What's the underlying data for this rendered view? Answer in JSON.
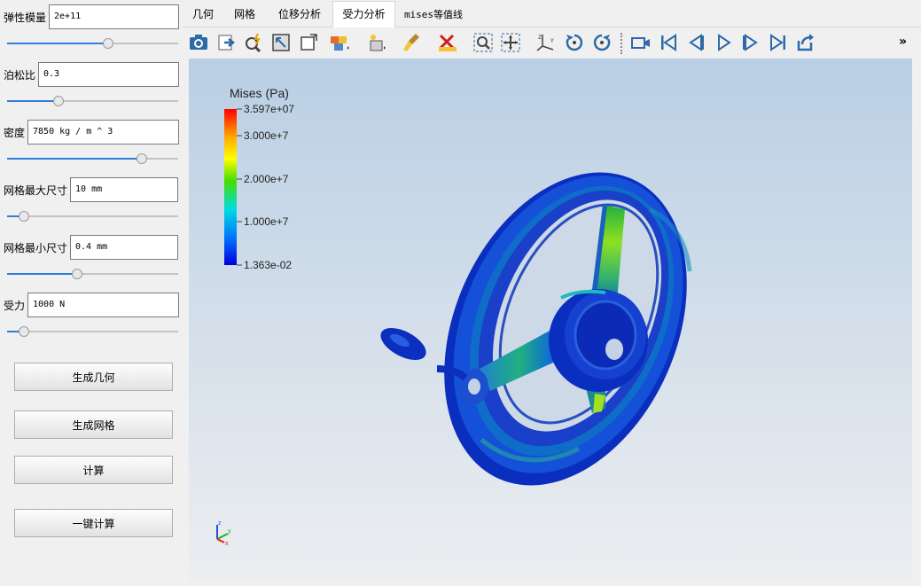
{
  "params": {
    "youngs_modulus": {
      "label": "弹性模量",
      "value": "2e+11",
      "slider": 0.59
    },
    "poisson_ratio": {
      "label": "泊松比",
      "value": "0.3",
      "slider": 0.3
    },
    "density": {
      "label": "密度",
      "value": "7850 kg / m ^ 3",
      "slider": 0.79
    },
    "max_mesh_size": {
      "label": "网格最大尺寸",
      "value": "10 mm",
      "slider": 0.1
    },
    "min_mesh_size": {
      "label": "网格最小尺寸",
      "value": "0.4 mm",
      "slider": 0.41
    },
    "force": {
      "label": "受力",
      "value": "1000 N",
      "slider": 0.1
    }
  },
  "buttons": {
    "generate_geometry": "生成几何",
    "generate_mesh": "生成网格",
    "compute": "计算",
    "one_click_compute": "一键计算"
  },
  "tabs": [
    "几何",
    "网格",
    "位移分析",
    "受力分析",
    "mises等值线"
  ],
  "active_tab": "受力分析",
  "toolbar": {
    "icons": [
      "camera-icon",
      "export-icon",
      "zoom-select-icon",
      "reset-view-icon",
      "box-icon",
      "color-cube-icon",
      "slice-icon",
      "brush-icon",
      "ruler-icon",
      "zoom-box-icon",
      "center-icon",
      "axes-icon",
      "rotate-cw-icon",
      "rotate-ccw-icon",
      "record-icon",
      "first-frame-icon",
      "prev-frame-icon",
      "play-icon",
      "next-frame-icon",
      "last-frame-icon",
      "loop-icon"
    ],
    "overflow": "»"
  },
  "legend": {
    "title": "Mises (Pa)",
    "labels": [
      "3.597e+07",
      "3.000e+7",
      "2.000e+7",
      "1.000e+7",
      "1.363e-02"
    ],
    "colors": [
      "#ff0000",
      "#ffaa00",
      "#ffff00",
      "#44dd00",
      "#00dddd",
      "#0077ff",
      "#0000dd"
    ]
  },
  "axes": {
    "x": "x",
    "y": "y",
    "z": "z"
  }
}
